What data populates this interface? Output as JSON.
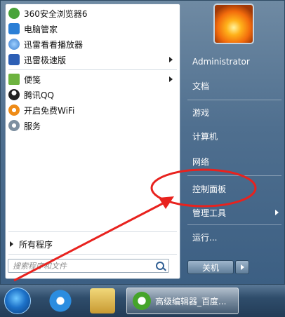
{
  "programs": [
    {
      "label": "360安全浏览器6",
      "icon": "browser-360-icon",
      "color": "#49a33a",
      "submenu": false
    },
    {
      "label": "电脑管家",
      "icon": "pc-manager-icon",
      "color": "#2b7fd6",
      "submenu": false
    },
    {
      "label": "迅雷看看播放器",
      "icon": "xunlei-player-icon",
      "color": "#3b7fd0",
      "submenu": false
    },
    {
      "label": "迅雷极速版",
      "icon": "xunlei-speed-icon",
      "color": "#2d5fb5",
      "submenu": true
    },
    {
      "label": "便笺",
      "icon": "sticky-notes-icon",
      "color": "#6db33f",
      "submenu": true
    },
    {
      "label": "腾讯QQ",
      "icon": "qq-penguin-icon",
      "color": "#222222",
      "submenu": false
    },
    {
      "label": "开启免费WiFi",
      "icon": "wifi-icon",
      "color": "#ee8b17",
      "submenu": false
    },
    {
      "label": "服务",
      "icon": "services-gear-icon",
      "color": "#7d8fa0",
      "submenu": false
    }
  ],
  "all_programs": "所有程序",
  "search": {
    "placeholder": "搜索程序和文件"
  },
  "right_items": [
    {
      "label": "Administrator",
      "submenu": false
    },
    {
      "label": "文档",
      "submenu": false
    },
    {
      "label": "游戏",
      "submenu": false
    },
    {
      "label": "计算机",
      "submenu": false
    },
    {
      "label": "网络",
      "submenu": false
    },
    {
      "label": "控制面板",
      "submenu": false
    },
    {
      "label": "管理工具",
      "submenu": true
    },
    {
      "label": "运行...",
      "submenu": false
    }
  ],
  "shutdown": {
    "label": "关机"
  },
  "taskbar": {
    "active_window": "高级编辑器_百度..."
  },
  "colors": {
    "annotation": "#e8221e",
    "menu_right_bg": "#4f6f8f",
    "left_pane_bg": "#ffffff"
  }
}
